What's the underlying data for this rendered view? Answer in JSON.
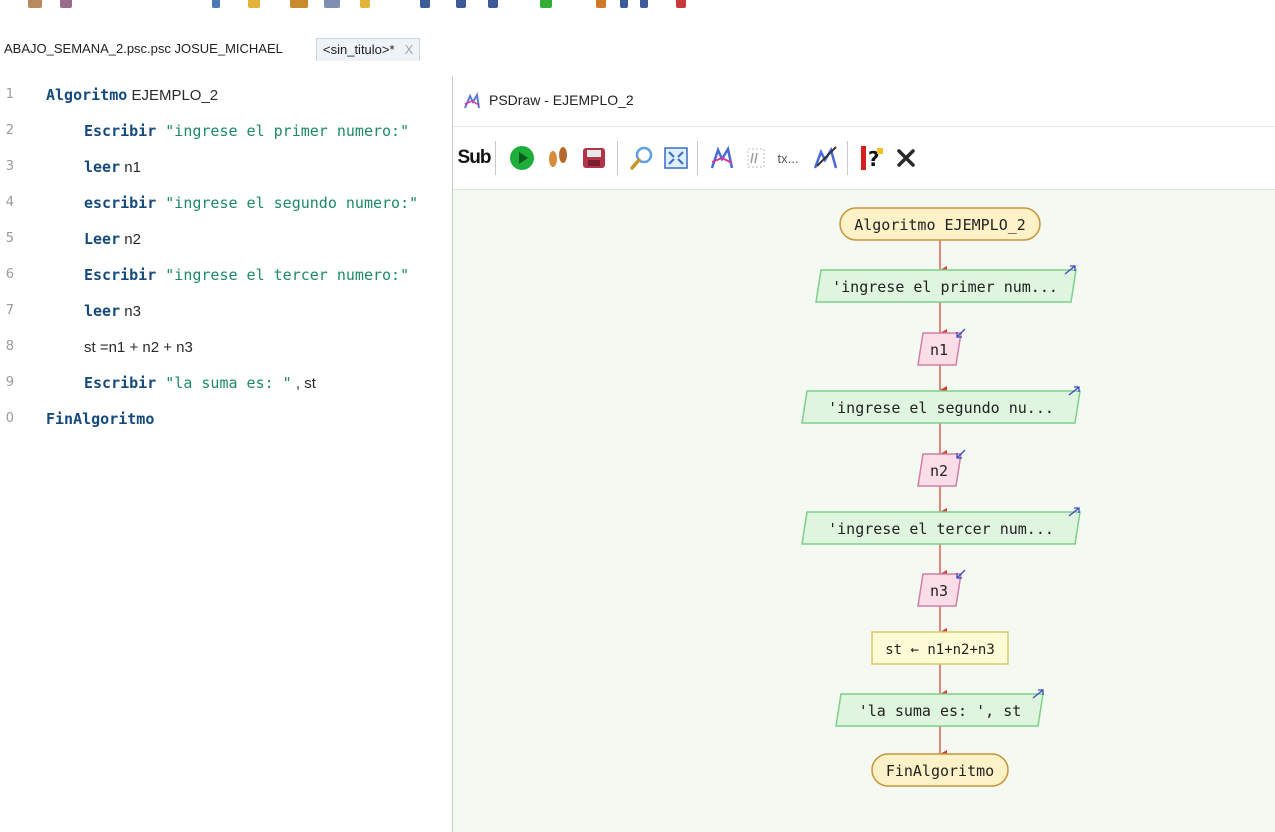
{
  "tabs": [
    {
      "label": "ABAJO_SEMANA_2.psc.psc JOSUE_MICHAEL"
    },
    {
      "label": "<sin_titulo>*",
      "close": "X"
    }
  ],
  "editor": {
    "lines": [
      {
        "num": "1",
        "kw": "Algoritmo",
        "rest": " EJEMPLO_2",
        "indent": 0
      },
      {
        "num": "2",
        "kw": "Escribir",
        "str": " \"ingrese el primer numero:\"",
        "indent": 1
      },
      {
        "num": "3",
        "kw": "leer",
        "rest": " n1",
        "indent": 1
      },
      {
        "num": "4",
        "kw": "escribir",
        "str": " \"ingrese el segundo numero:\"",
        "indent": 1
      },
      {
        "num": "5",
        "kw": "Leer",
        "rest": " n2",
        "indent": 1
      },
      {
        "num": "6",
        "kw": "Escribir",
        "str": " \"ingrese el tercer numero:\"",
        "indent": 1
      },
      {
        "num": "7",
        "kw": "leer",
        "rest": " n3",
        "indent": 1
      },
      {
        "num": "8",
        "kw": "",
        "rest": "st =n1 + n2 + n3",
        "indent": 1
      },
      {
        "num": "9",
        "kw": "Escribir",
        "str": " \"la suma es: \"",
        "rest": " , st",
        "indent": 1
      },
      {
        "num": "0",
        "kw": "FinAlgoritmo",
        "rest": "",
        "indent": 0
      }
    ]
  },
  "psdraw": {
    "title": "PSDraw - EJEMPLO_2",
    "toolbar": {
      "sub_label": "Sub",
      "tx_label": "tx..."
    },
    "flowchart": {
      "start": "Algoritmo EJEMPLO_2",
      "out1": "'ingrese el primer num...",
      "in1": "n1",
      "out2": "'ingrese el segundo nu...",
      "in2": "n2",
      "out3": "'ingrese el tercer num...",
      "in3": "n3",
      "assign": "st ← n1+n2+n3",
      "out4": "'la suma es: ', st",
      "end": "FinAlgoritmo"
    }
  },
  "colors": {
    "keyword": "#154a7c",
    "string": "#1c8a63",
    "start_end_fill": "#fdf1c8",
    "start_end_stroke": "#c8943a",
    "output_fill": "#dff5df",
    "output_stroke": "#7fcf8a",
    "input_fill": "#fbdde8",
    "input_stroke": "#d07fa6",
    "assign_fill": "#fdfbd6",
    "assign_stroke": "#d8c86a",
    "arrow": "#d23a2a"
  }
}
